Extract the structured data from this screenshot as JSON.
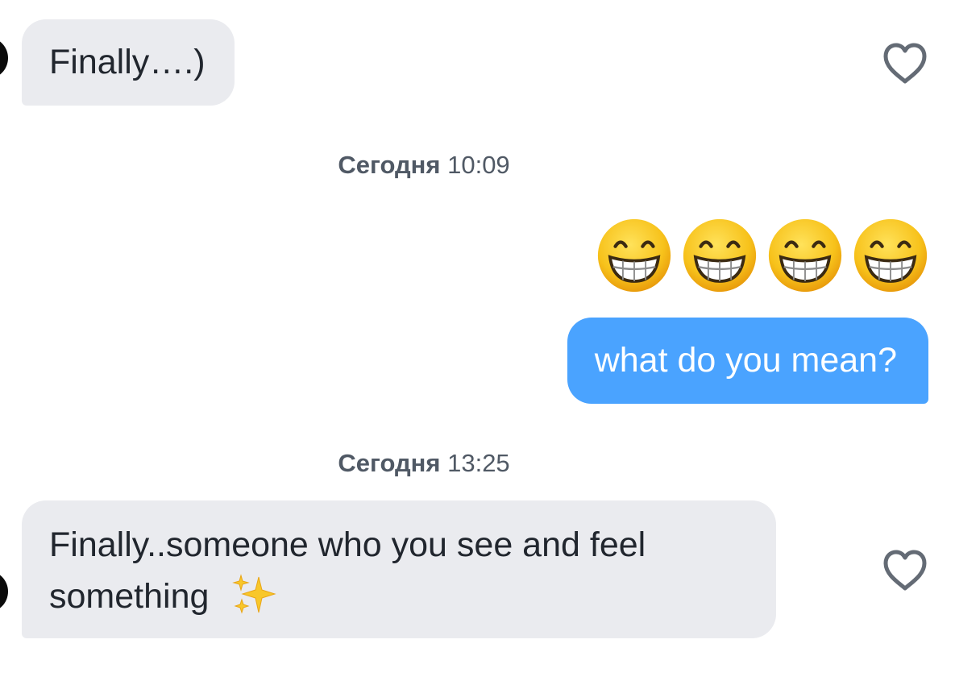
{
  "messages": [
    {
      "text": "Finally….)",
      "direction": "incoming"
    },
    {
      "timestamp": {
        "day": "Сегодня",
        "time": "10:09"
      }
    },
    {
      "emojis": [
        "grinning-face-with-smiling-eyes",
        "grinning-face-with-smiling-eyes",
        "grinning-face-with-smiling-eyes",
        "grinning-face-with-smiling-eyes"
      ],
      "direction": "outgoing"
    },
    {
      "text": "what do you mean?",
      "direction": "outgoing"
    },
    {
      "timestamp": {
        "day": "Сегодня",
        "time": "13:25"
      }
    },
    {
      "text_line1": "Finally..someone who you see and feel",
      "text_line2": "something",
      "trailing_emoji": "sparkles",
      "direction": "incoming"
    }
  ],
  "colors": {
    "incoming_bubble": "#eaebef",
    "outgoing_bubble": "#4aa3ff",
    "timestamp_text": "#505965",
    "heart_stroke": "#646b75"
  },
  "icons": {
    "like": "heart-outline-icon",
    "avatar": "avatar"
  }
}
